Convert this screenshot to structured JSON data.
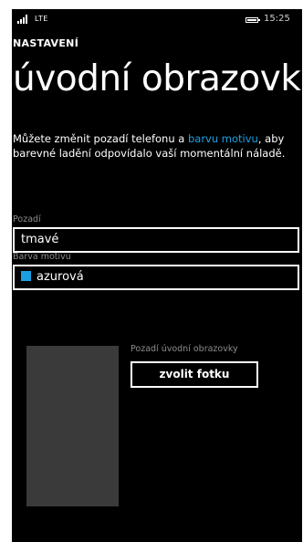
{
  "status_bar": {
    "network": "LTE",
    "time": "15:25"
  },
  "header": {
    "app_title": "NASTAVENÍ",
    "page_title": "úvodní obrazovka"
  },
  "description": {
    "text_before_link": "Můžete změnit pozadí telefonu a ",
    "link_text": "barvu motivu",
    "text_after_link": ", aby barevné ladění odpovídalo vaší momentální náladě."
  },
  "background_field": {
    "label": "Pozadí",
    "value": "tmavé"
  },
  "theme_color_field": {
    "label": "Barva motivu",
    "value": "azurová",
    "swatch_color": "#1ba1e2"
  },
  "start_background": {
    "label": "Pozadí úvodní obrazovky",
    "button_label": "zvolit fotku"
  },
  "colors": {
    "accent": "#1ba1e2",
    "background": "#000000",
    "label_gray": "#8c8c8c",
    "preview_tile": "#3a3a3a"
  }
}
